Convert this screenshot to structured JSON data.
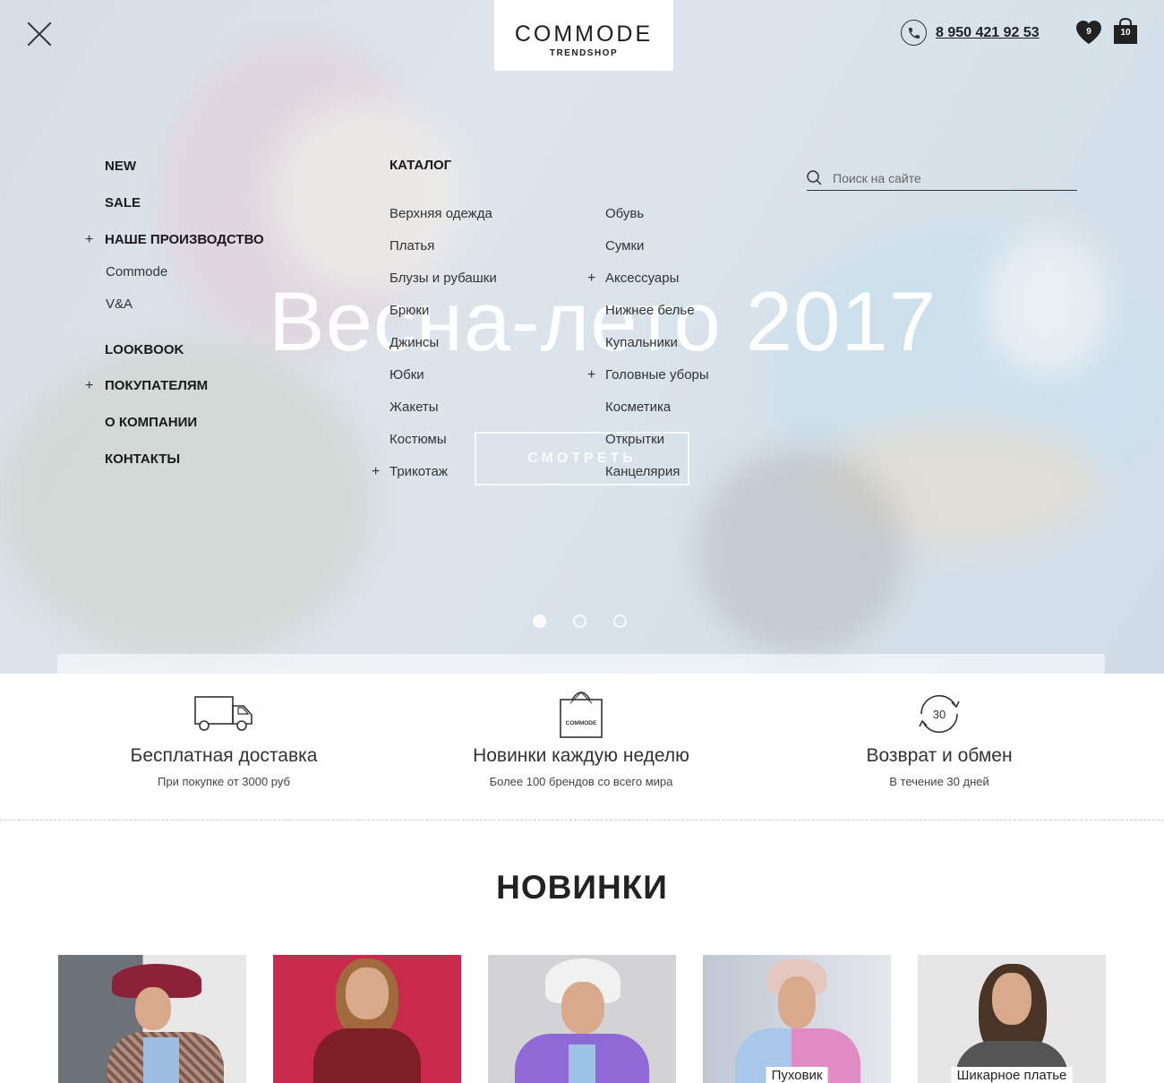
{
  "header": {
    "logo_main": "COMMODE",
    "logo_sub": "TRENDSHOP",
    "phone": "8 950 421 92 53",
    "wishlist_count": "9",
    "cart_count": "10"
  },
  "hero": {
    "title": "Весна-лето 2017",
    "button": "СМОТРЕТЬ"
  },
  "menu": {
    "new": "NEW",
    "sale": "SALE",
    "production": "НАШЕ ПРОИЗВОДСТВО",
    "production_sub1": "Commode",
    "production_sub2": "V&A",
    "lookbook": "LOOKBOOK",
    "buyers": "ПОКУПАТЕЛЯМ",
    "about": "О КОМПАНИИ",
    "contacts": "КОНТАКТЫ"
  },
  "catalog": {
    "title": "КАТАЛОГ",
    "col1": [
      "Верхняя одежда",
      "Платья",
      "Блузы и рубашки",
      "Брюки",
      "Джинсы",
      "Юбки",
      "Жакеты",
      "Костюмы",
      "Трикотаж"
    ],
    "col2": [
      "Обувь",
      "Сумки",
      "Аксессуары",
      "Нижнее белье",
      "Купальники",
      "Головные уборы",
      "Косметика",
      "Открытки",
      "Канцелярия"
    ]
  },
  "search": {
    "placeholder": "Поиск на сайте"
  },
  "features": [
    {
      "title": "Бесплатная доставка",
      "subtitle": "При покупке от 3000 руб",
      "icon": "truck-icon"
    },
    {
      "title": "Новинки каждую неделю",
      "subtitle": "Более 100 брендов со всего мира",
      "icon": "shopping-bag-icon",
      "bag_text": "COMMODE"
    },
    {
      "title": "Возврат и обмен",
      "subtitle": "В течение 30 дней",
      "icon": "return-30-icon",
      "badge": "30"
    }
  ],
  "new_section": {
    "title": "НОВИНКИ",
    "products": [
      {
        "label": ""
      },
      {
        "label": ""
      },
      {
        "label": ""
      },
      {
        "label": "Пуховик"
      },
      {
        "label": "Шикарное платье"
      }
    ]
  },
  "colors": {
    "accent": "#222222",
    "hero_overlay": "#ebf0f5"
  }
}
